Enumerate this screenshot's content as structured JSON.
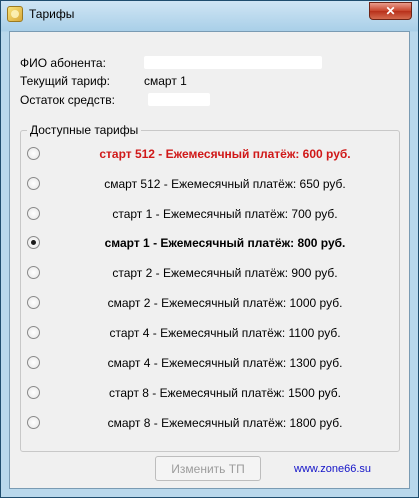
{
  "window": {
    "title": "Тарифы",
    "close_symbol": "✕"
  },
  "subscriber": {
    "name_label": "ФИО абонента:",
    "tariff_label": "Текущий тариф:",
    "tariff_value": "смарт 1",
    "balance_label": "Остаток средств:"
  },
  "tariffs_group": {
    "legend": "Доступные тарифы",
    "options": [
      {
        "label": "старт 512 - Ежемесячный платёж: 600 руб.",
        "selected": false,
        "highlight": "red-bold"
      },
      {
        "label": "смарт 512 - Ежемесячный платёж: 650 руб.",
        "selected": false,
        "highlight": "none"
      },
      {
        "label": "старт 1 - Ежемесячный платёж: 700 руб.",
        "selected": false,
        "highlight": "none"
      },
      {
        "label": "смарт 1 - Ежемесячный платёж: 800 руб.",
        "selected": true,
        "highlight": "bold"
      },
      {
        "label": "старт 2 - Ежемесячный платёж: 900 руб.",
        "selected": false,
        "highlight": "none"
      },
      {
        "label": "смарт 2 - Ежемесячный платёж: 1000 руб.",
        "selected": false,
        "highlight": "none"
      },
      {
        "label": "старт 4 - Ежемесячный платёж: 1100 руб.",
        "selected": false,
        "highlight": "none"
      },
      {
        "label": "смарт 4 - Ежемесячный платёж: 1300 руб.",
        "selected": false,
        "highlight": "none"
      },
      {
        "label": "старт 8 - Ежемесячный платёж: 1500 руб.",
        "selected": false,
        "highlight": "none"
      },
      {
        "label": "смарт 8 - Ежемесячный платёж: 1800 руб.",
        "selected": false,
        "highlight": "none"
      }
    ]
  },
  "footer": {
    "change_button": "Изменить ТП",
    "site_link": "www.zone66.su"
  },
  "colors": {
    "highlight_red": "#d01818",
    "link_blue": "#1414c8",
    "disabled_text": "#9c9c9c"
  }
}
